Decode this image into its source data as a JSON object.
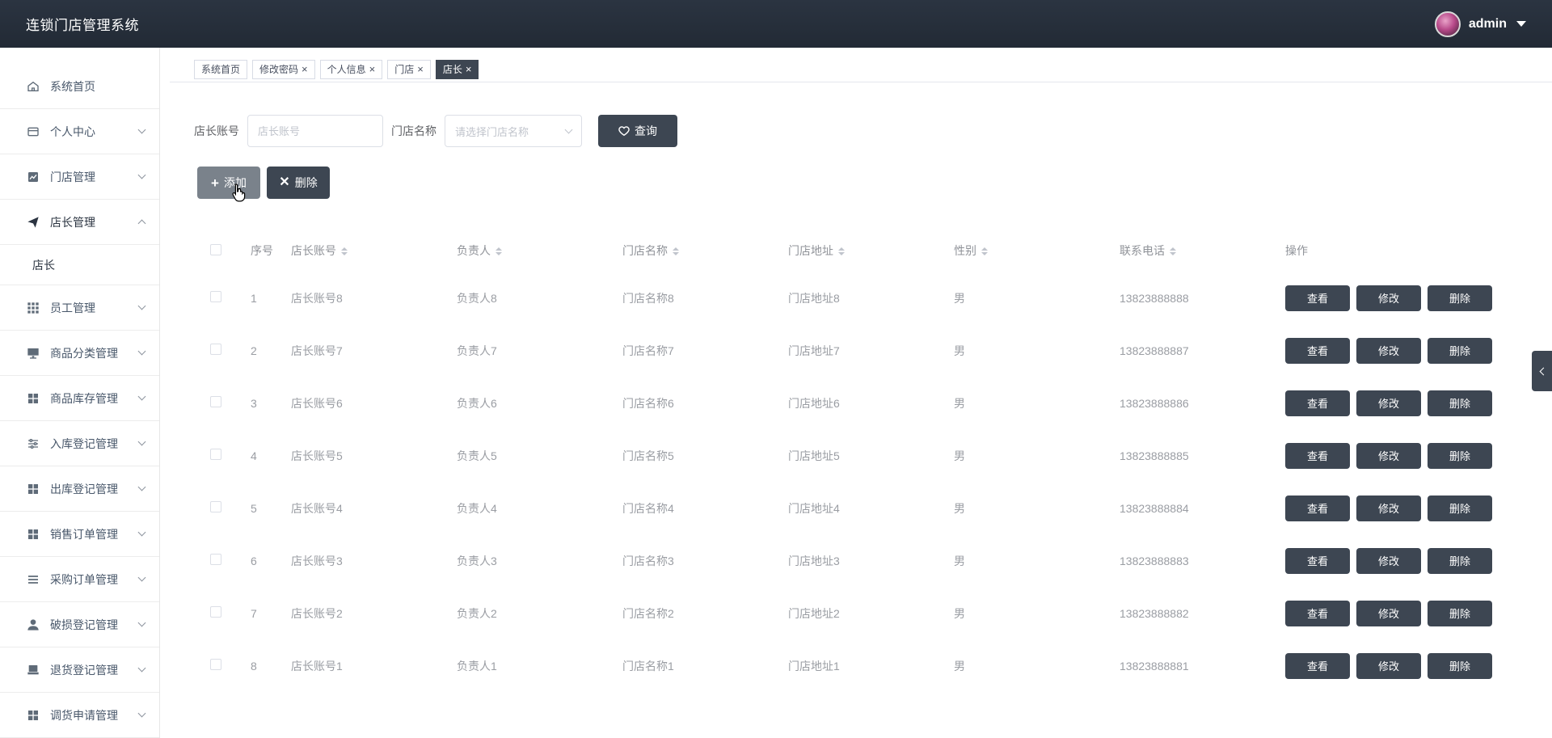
{
  "app": {
    "title": "连锁门店管理系统"
  },
  "user": {
    "name": "admin"
  },
  "sidebar": {
    "items": [
      {
        "label": "系统首页",
        "icon": "home-icon",
        "has_chevron": false
      },
      {
        "label": "个人中心",
        "icon": "id-card-icon",
        "has_chevron": true
      },
      {
        "label": "门店管理",
        "icon": "chart-icon",
        "has_chevron": true
      },
      {
        "label": "店长管理",
        "icon": "send-icon",
        "has_chevron": true,
        "expanded": true
      },
      {
        "label": "员工管理",
        "icon": "grid-icon",
        "has_chevron": true
      },
      {
        "label": "商品分类管理",
        "icon": "monitor-icon",
        "has_chevron": true
      },
      {
        "label": "商品库存管理",
        "icon": "apps-icon",
        "has_chevron": true
      },
      {
        "label": "入库登记管理",
        "icon": "sliders-icon",
        "has_chevron": true
      },
      {
        "label": "出库登记管理",
        "icon": "apps-icon",
        "has_chevron": true
      },
      {
        "label": "销售订单管理",
        "icon": "apps-icon",
        "has_chevron": true
      },
      {
        "label": "采购订单管理",
        "icon": "list-icon",
        "has_chevron": true
      },
      {
        "label": "破损登记管理",
        "icon": "user-icon",
        "has_chevron": true
      },
      {
        "label": "退货登记管理",
        "icon": "box-icon",
        "has_chevron": true
      },
      {
        "label": "调货申请管理",
        "icon": "apps-icon",
        "has_chevron": true
      }
    ],
    "submenu_label": "店长"
  },
  "tags": [
    {
      "label": "系统首页",
      "closable": false,
      "active": false
    },
    {
      "label": "修改密码",
      "closable": true,
      "active": false
    },
    {
      "label": "个人信息",
      "closable": true,
      "active": false
    },
    {
      "label": "门店",
      "closable": true,
      "active": false
    },
    {
      "label": "店长",
      "closable": true,
      "active": true
    }
  ],
  "search": {
    "account_label": "店长账号",
    "account_placeholder": "店长账号",
    "store_label": "门店名称",
    "store_placeholder": "请选择门店名称",
    "query_label": "查询"
  },
  "actions": {
    "add_label": "添加",
    "delete_label": "删除"
  },
  "table": {
    "headers": [
      "序号",
      "店长账号",
      "负责人",
      "门店名称",
      "门店地址",
      "性别",
      "联系电话",
      "操作"
    ],
    "rows": [
      [
        "1",
        "店长账号8",
        "负责人8",
        "门店名称8",
        "门店地址8",
        "男",
        "13823888888"
      ],
      [
        "2",
        "店长账号7",
        "负责人7",
        "门店名称7",
        "门店地址7",
        "男",
        "13823888887"
      ],
      [
        "3",
        "店长账号6",
        "负责人6",
        "门店名称6",
        "门店地址6",
        "男",
        "13823888886"
      ],
      [
        "4",
        "店长账号5",
        "负责人5",
        "门店名称5",
        "门店地址5",
        "男",
        "13823888885"
      ],
      [
        "5",
        "店长账号4",
        "负责人4",
        "门店名称4",
        "门店地址4",
        "男",
        "13823888884"
      ],
      [
        "6",
        "店长账号3",
        "负责人3",
        "门店名称3",
        "门店地址3",
        "男",
        "13823888883"
      ],
      [
        "7",
        "店长账号2",
        "负责人2",
        "门店名称2",
        "门店地址2",
        "男",
        "13823888882"
      ],
      [
        "8",
        "店长账号1",
        "负责人1",
        "门店名称1",
        "门店地址1",
        "男",
        "13823888881"
      ]
    ],
    "row_actions": {
      "view": "查看",
      "edit": "修改",
      "delete": "删除"
    }
  },
  "colors": {
    "header_bg": "#2b3441",
    "button_dark": "#3d4652",
    "active_tag": "#3d4652"
  }
}
